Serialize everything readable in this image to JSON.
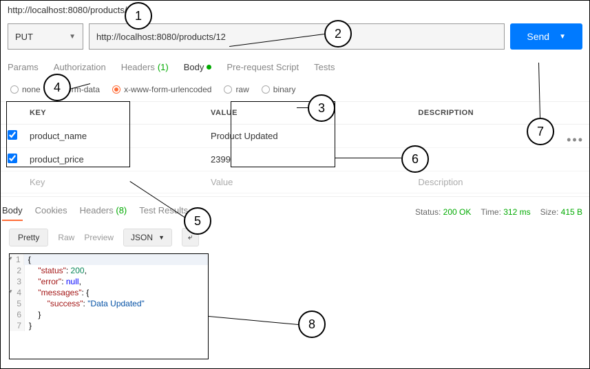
{
  "url_bar": "http://localhost:8080/products/12",
  "request": {
    "method": "PUT",
    "url": "http://localhost:8080/products/12",
    "send_label": "Send"
  },
  "tabs": {
    "params": "Params",
    "auth": "Authorization",
    "headers": "Headers",
    "headers_count": "(1)",
    "body": "Body",
    "prereq": "Pre-request Script",
    "tests": "Tests"
  },
  "body_types": {
    "none": "none",
    "formdata": "form-data",
    "urlenc": "x-www-form-urlencoded",
    "raw": "raw",
    "binary": "binary"
  },
  "kv": {
    "hdr_key": "KEY",
    "hdr_value": "VALUE",
    "hdr_desc": "DESCRIPTION",
    "rows": [
      {
        "key": "product_name",
        "value": "Product Updated",
        "desc": ""
      },
      {
        "key": "product_price",
        "value": "2399",
        "desc": ""
      }
    ],
    "ph_key": "Key",
    "ph_value": "Value",
    "ph_desc": "Description"
  },
  "resp_tabs": {
    "body": "Body",
    "cookies": "Cookies",
    "headers": "Headers",
    "headers_count": "(8)",
    "tests": "Test Results"
  },
  "resp_meta": {
    "status_label": "Status:",
    "status_value": "200 OK",
    "time_label": "Time:",
    "time_value": "312 ms",
    "size_label": "Size:",
    "size_value": "415 B"
  },
  "resp_toolbar": {
    "pretty": "Pretty",
    "raw": "Raw",
    "preview": "Preview",
    "fmt": "JSON"
  },
  "code": {
    "l1": "{",
    "l2a": "    \"status\"",
    "l2b": ": ",
    "l2c": "200",
    "l2d": ",",
    "l3a": "    \"error\"",
    "l3b": ": ",
    "l3c": "null",
    "l3d": ",",
    "l4a": "    \"messages\"",
    "l4b": ": {",
    "l5a": "        \"success\"",
    "l5b": ": ",
    "l5c": "\"Data Updated\"",
    "l6": "    }",
    "l7": "}"
  },
  "callouts": {
    "c1": "1",
    "c2": "2",
    "c3": "3",
    "c4": "4",
    "c5": "5",
    "c6": "6",
    "c7": "7",
    "c8": "8"
  }
}
